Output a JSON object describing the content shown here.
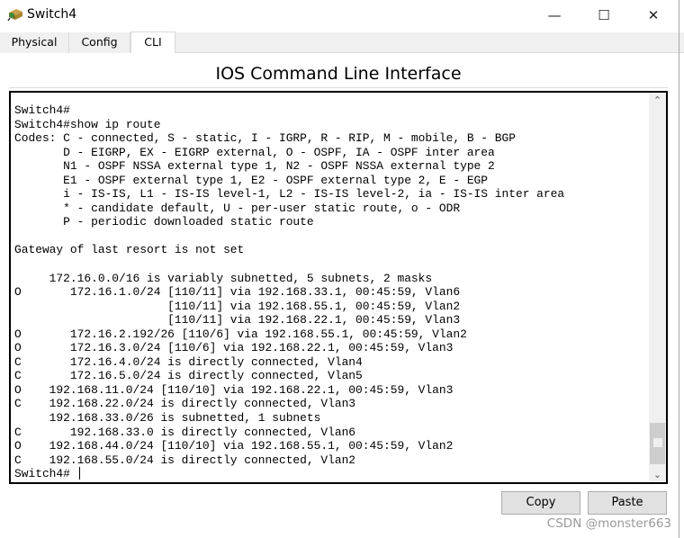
{
  "window": {
    "title": "Switch4",
    "icon": "switch-icon",
    "controls": [
      "minimize",
      "maximize",
      "close"
    ]
  },
  "tabs": [
    {
      "label": "Physical"
    },
    {
      "label": "Config"
    },
    {
      "label": "CLI",
      "active": true
    }
  ],
  "heading": "IOS Command Line Interface",
  "terminal": {
    "lines": [
      "Switch4#",
      "Switch4#show ip route",
      "Codes: C - connected, S - static, I - IGRP, R - RIP, M - mobile, B - BGP",
      "       D - EIGRP, EX - EIGRP external, O - OSPF, IA - OSPF inter area",
      "       N1 - OSPF NSSA external type 1, N2 - OSPF NSSA external type 2",
      "       E1 - OSPF external type 1, E2 - OSPF external type 2, E - EGP",
      "       i - IS-IS, L1 - IS-IS level-1, L2 - IS-IS level-2, ia - IS-IS inter area",
      "       * - candidate default, U - per-user static route, o - ODR",
      "       P - periodic downloaded static route",
      "",
      "Gateway of last resort is not set",
      "",
      "     172.16.0.0/16 is variably subnetted, 5 subnets, 2 masks",
      "O       172.16.1.0/24 [110/11] via 192.168.33.1, 00:45:59, Vlan6",
      "                      [110/11] via 192.168.55.1, 00:45:59, Vlan2",
      "                      [110/11] via 192.168.22.1, 00:45:59, Vlan3",
      "O       172.16.2.192/26 [110/6] via 192.168.55.1, 00:45:59, Vlan2",
      "O       172.16.3.0/24 [110/6] via 192.168.22.1, 00:45:59, Vlan3",
      "C       172.16.4.0/24 is directly connected, Vlan4",
      "C       172.16.5.0/24 is directly connected, Vlan5",
      "O    192.168.11.0/24 [110/10] via 192.168.22.1, 00:45:59, Vlan3",
      "C    192.168.22.0/24 is directly connected, Vlan3",
      "     192.168.33.0/26 is subnetted, 1 subnets",
      "C       192.168.33.0 is directly connected, Vlan6",
      "O    192.168.44.0/24 [110/10] via 192.168.55.1, 00:45:59, Vlan2",
      "C    192.168.55.0/24 is directly connected, Vlan2"
    ],
    "prompt": "Switch4# "
  },
  "buttons": {
    "copy": "Copy",
    "paste": "Paste"
  },
  "watermark": "CSDN @monster663"
}
